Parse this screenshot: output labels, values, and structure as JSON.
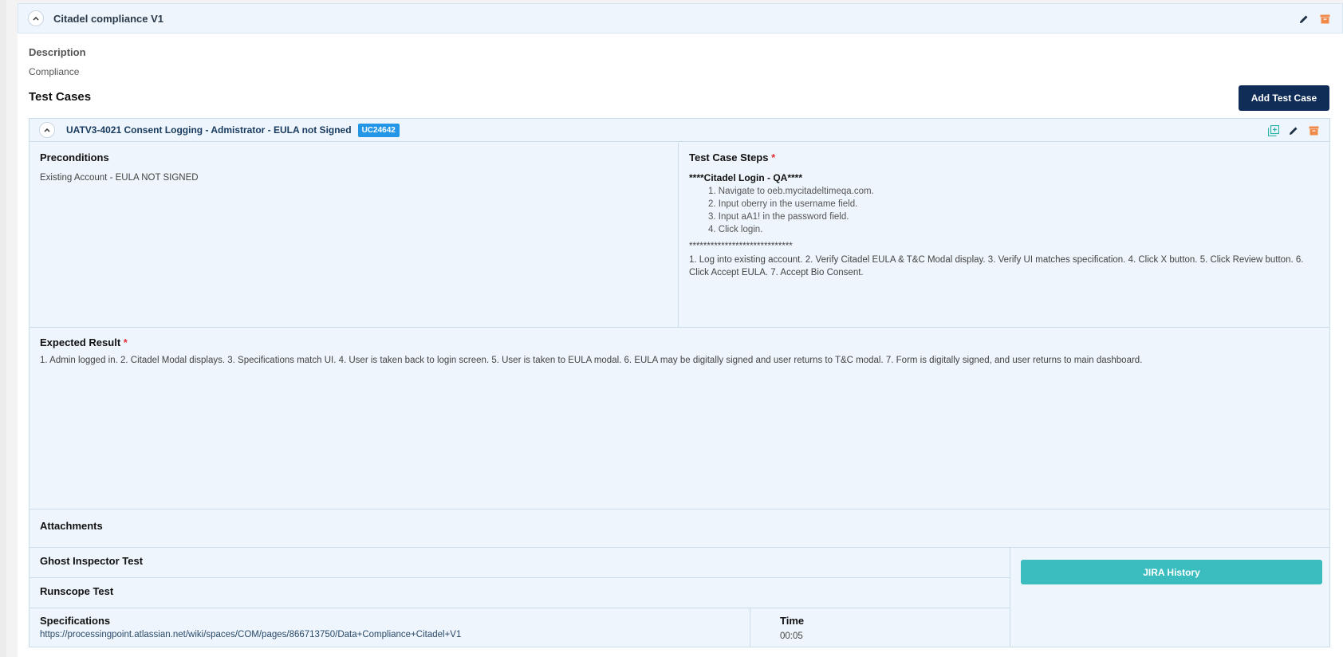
{
  "suite": {
    "title": "Citadel compliance V1",
    "description_label": "Description",
    "description_value": "Compliance",
    "test_cases_heading": "Test Cases",
    "add_test_case_label": "Add Test Case"
  },
  "test_case": {
    "title": "UATV3-4021 Consent Logging - Admistrator - EULA not Signed",
    "badge": "UC24642",
    "preconditions_label": "Preconditions",
    "preconditions_value": "Existing Account - EULA NOT SIGNED",
    "steps_label": "Test Case Steps",
    "required_mark": "*",
    "steps_heading": "****Citadel Login - QA****",
    "steps_list": [
      "1. Navigate to oeb.mycitadeltimeqa.com.",
      "2. Input oberry in the username field.",
      "3. Input aA1! in the password field.",
      "4. Click login."
    ],
    "steps_separator": "*****************************",
    "steps_text": "1. Log into existing account. 2. Verify Citadel EULA & T&C Modal display. 3. Verify UI matches specification. 4. Click X button. 5. Click Review button. 6. Click Accept EULA. 7. Accept Bio Consent.",
    "expected_label": "Expected Result",
    "expected_value": "1. Admin logged in. 2. Citadel Modal displays. 3. Specifications match UI. 4. User is taken back to login screen. 5. User is taken to EULA modal. 6. EULA may be digitally signed and user returns to T&C modal. 7. Form is digitally signed, and user returns to main dashboard.",
    "attachments_label": "Attachments",
    "ghost_label": "Ghost Inspector Test",
    "runscope_label": "Runscope Test",
    "specifications_label": "Specifications",
    "specifications_link": "https://processingpoint.atlassian.net/wiki/spaces/COM/pages/866713750/Data+Compliance+Citadel+V1",
    "time_label": "Time",
    "time_value": "00:05",
    "jira_history_label": "JIRA History"
  },
  "icons": {
    "collapse": "chevron-up-icon",
    "edit": "pencil-icon",
    "archive": "archive-icon",
    "copy": "copy-plus-icon"
  },
  "colors": {
    "primary_button": "#0f2d57",
    "jira_button": "#3bbdc0",
    "badge": "#2496e8",
    "archive_icon": "#f08a4b",
    "copy_icon": "#2bb3a8",
    "required": "#e0303a",
    "panel_bg": "#eef5fc"
  }
}
